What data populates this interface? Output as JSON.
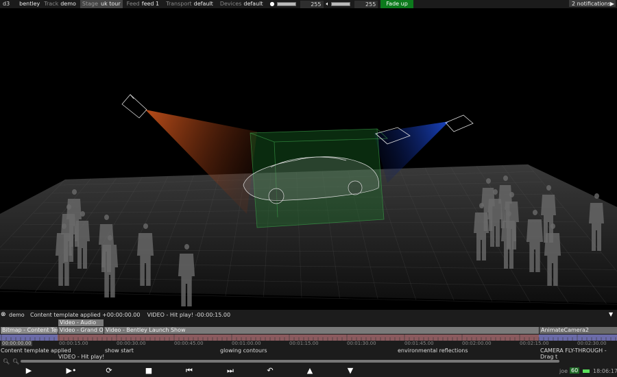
{
  "topbar": {
    "app": "d3",
    "project": "bentley",
    "track_label": "Track",
    "track": "demo",
    "stage_label": "Stage",
    "stage": "uk tour",
    "feed_label": "Feed",
    "feed": "feed 1",
    "transport_label": "Transport",
    "transport": "default",
    "devices_label": "Devices",
    "devices": "default",
    "brightness": "255",
    "volume": "255",
    "brightness_level": 1.0,
    "volume_level": 1.0,
    "fade_button": "Fade up",
    "notifications": "2 notifications",
    "fade_color": "#0c7a1c"
  },
  "timeline": {
    "track": "demo",
    "status": "Content template applied +00:00:00.00    VIDEO - Hit play! -00:00:15.00",
    "layers": [
      {
        "label": "Video - Audio"
      },
      {
        "label": "Bitmap - Content Templ"
      },
      {
        "label": "Video - Grand Ope"
      },
      {
        "label": "Video - Bentley Launch Show"
      },
      {
        "label": "AnimateCamera2"
      }
    ],
    "times": [
      "00:00:00.00",
      "00:00:15.00",
      "00:00:30.00",
      "00:00:45.00",
      "00:01:00.00",
      "00:01:15.00",
      "00:01:30.00",
      "00:01:45.00",
      "00:02:00.00",
      "00:02:15.00",
      "00:02:30.00"
    ],
    "markers": [
      "Content template applied",
      "VIDEO - Hit play!",
      "show start",
      "glowing contours",
      "environmental reflections",
      "CAMERA FLY-THROUGH - Drag t"
    ]
  },
  "status": {
    "user": "joe",
    "fps": "60",
    "clock": "18:06:17"
  }
}
